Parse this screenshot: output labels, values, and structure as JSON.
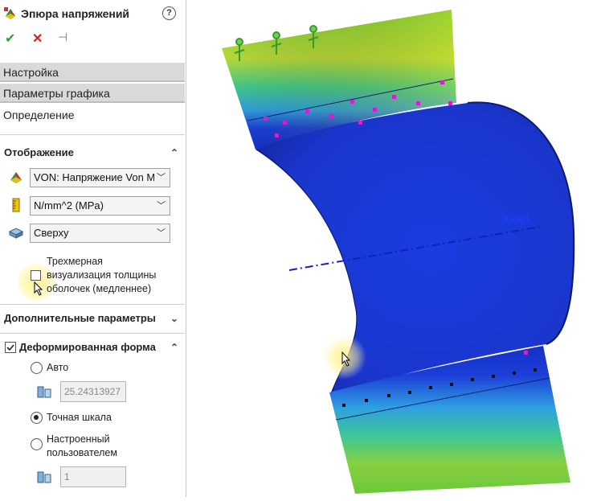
{
  "panel": {
    "title": "Эпюра напряжений",
    "help_icon": "?",
    "actions": {
      "ok_icon": "✔",
      "cancel_icon": "✕",
      "pin_icon": "⊣"
    },
    "tabs": [
      {
        "label": "Настройка"
      },
      {
        "label": "Параметры графика"
      },
      {
        "label": "Определение"
      }
    ],
    "display_section": {
      "title": "Отображение",
      "component_select": "VON: Напряжение Von M",
      "units_select": "N/mm^2 (MPa)",
      "position_select": "Сверху",
      "shell_checkbox_label_1": "Трехмерная",
      "shell_checkbox_label_2": "визуализация толщины",
      "shell_checkbox_label_3": "оболочек (медленнее)"
    },
    "advanced_section": {
      "title": "Дополнительные параметры"
    },
    "deformed_section": {
      "title": "Деформированная форма",
      "radio_auto": "Авто",
      "auto_value": "25.24313927",
      "radio_true_scale": "Точная шкала",
      "radio_user_1": "Настроенный",
      "radio_user_2": "пользователем",
      "user_value": "1"
    }
  },
  "viewport": {
    "axis_label": "Axis1"
  },
  "colors": {
    "accent_check": "#2e9e2e",
    "accent_cancel": "#d22020",
    "tab_bg": "#d9d9d9",
    "stress_low": "#1030d0",
    "stress_mid": "#40c060",
    "stress_high": "#e0e020"
  }
}
